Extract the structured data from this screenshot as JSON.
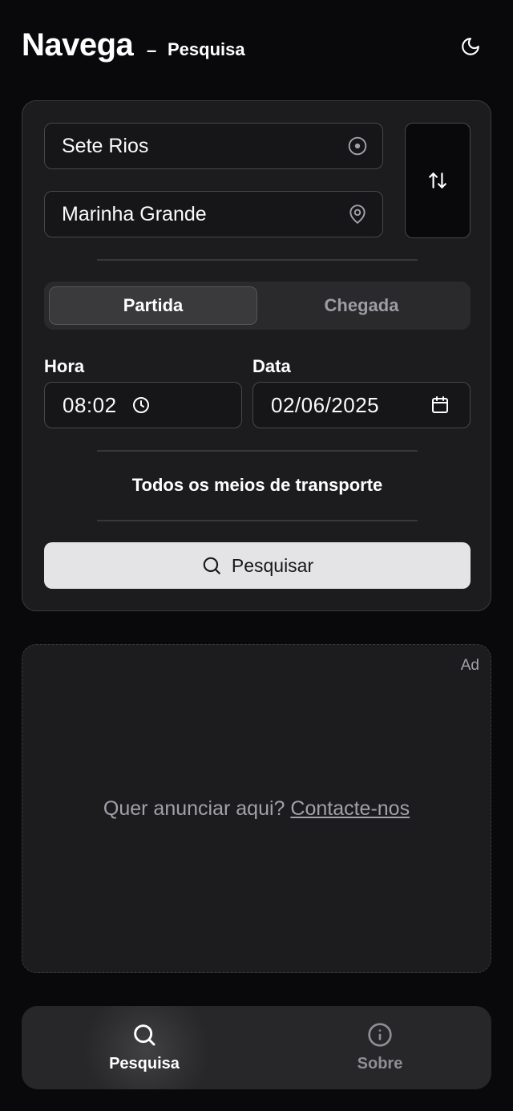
{
  "header": {
    "app_title": "Navega",
    "separator": "–",
    "page_title": "Pesquisa",
    "theme_icon": "moon-icon"
  },
  "search": {
    "origin_value": "Sete Rios",
    "origin_icon": "locate-icon",
    "destination_value": "Marinha Grande",
    "destination_icon": "map-pin-icon",
    "swap_icon": "swap-vertical-icon",
    "mode_options": [
      "Partida",
      "Chegada"
    ],
    "mode_selected": "Partida",
    "time_label": "Hora",
    "time_value": "08:02",
    "time_icon": "clock-icon",
    "date_label": "Data",
    "date_value": "02/06/2025",
    "date_icon": "calendar-icon",
    "transport_label": "Todos os meios de transporte",
    "submit_label": "Pesquisar",
    "submit_icon": "search-icon"
  },
  "ad": {
    "tag": "Ad",
    "prompt": "Quer anunciar aqui?",
    "link": "Contacte-nos"
  },
  "bottom_nav": {
    "items": [
      {
        "label": "Pesquisa",
        "icon": "search-icon",
        "active": true
      },
      {
        "label": "Sobre",
        "icon": "info-icon",
        "active": false
      }
    ]
  },
  "colors": {
    "background": "#09090b",
    "card": "#1c1c1e",
    "primary_button": "#e4e4e7",
    "muted_text": "#a1a1aa"
  }
}
